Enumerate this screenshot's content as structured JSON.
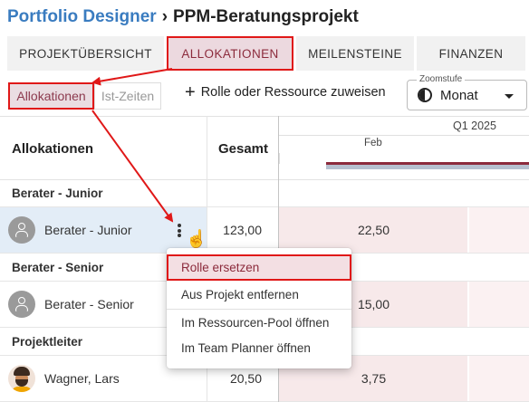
{
  "breadcrumb": {
    "root": "Portfolio Designer",
    "separator": "›",
    "current": "PPM-Beratungsprojekt"
  },
  "tabs": [
    {
      "label": "PROJEKTÜBERSICHT"
    },
    {
      "label": "ALLOKATIONEN",
      "active": true
    },
    {
      "label": "MEILENSTEINE"
    },
    {
      "label": "FINANZEN"
    }
  ],
  "toolbar": {
    "seg_allocations": "Allokationen",
    "seg_actuals": "Ist-Zeiten",
    "assign_label": "Rolle oder Ressource zuweisen",
    "zoom_legend": "Zoomstufe",
    "zoom_value": "Monat"
  },
  "grid": {
    "col_allocations": "Allokationen",
    "col_total": "Gesamt",
    "quarter": "Q1 2025",
    "month": "Feb",
    "groups": [
      {
        "label": "Berater - Junior",
        "rows": [
          {
            "name": "Berater - Junior",
            "total": "123,00",
            "feb": "22,50",
            "selected": true
          }
        ]
      },
      {
        "label": "Berater - Senior",
        "rows": [
          {
            "name": "Berater - Senior",
            "total": "",
            "feb": "15,00"
          }
        ]
      },
      {
        "label": "Projektleiter",
        "rows": [
          {
            "name": "Wagner, Lars",
            "total": "20,50",
            "feb": "3,75"
          }
        ]
      }
    ]
  },
  "context_menu": {
    "items": [
      {
        "label": "Rolle ersetzen"
      },
      {
        "label": "Aus Projekt entfernen"
      },
      {
        "label": "Im Ressourcen-Pool öffnen"
      },
      {
        "label": "Im Team Planner öffnen"
      }
    ]
  },
  "colors": {
    "accent": "#8c2b3c",
    "highlight": "#e01818",
    "link": "#3a7cc0"
  }
}
